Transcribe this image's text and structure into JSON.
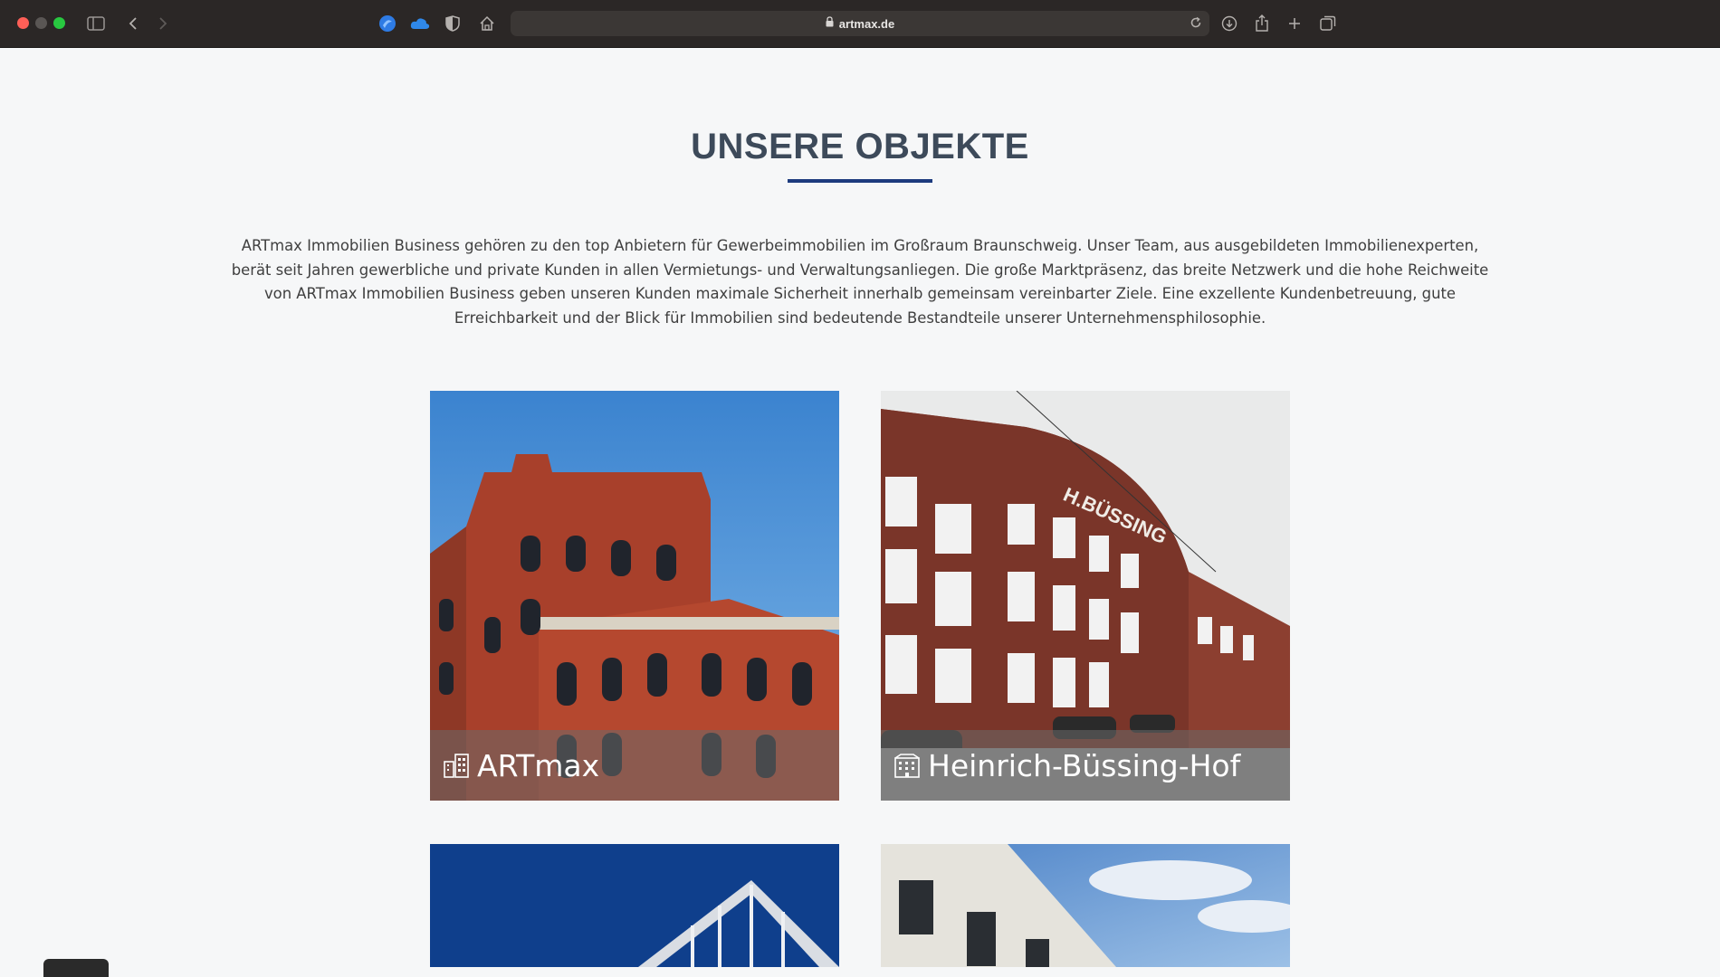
{
  "browser": {
    "url": "artmax.de",
    "icons": [
      "sidebar-icon",
      "back-icon",
      "forward-icon",
      "extension-icon",
      "cloud-icon",
      "shield-icon",
      "home-icon",
      "lock-icon",
      "reload-icon",
      "download-icon",
      "share-icon",
      "new-tab-icon",
      "tabs-overview-icon"
    ]
  },
  "page": {
    "title": "UNSERE OBJEKTE",
    "intro": "ARTmax Immobilien Business gehören zu den top Anbietern für Gewerbeimmobilien im Großraum Braunschweig. Unser Team, aus ausgebildeten Immobilienexperten, berät seit Jahren gewerbliche und private Kunden in allen Vermietungs- und Verwaltungsanliegen. Die große Marktpräsenz, das breite Netzwerk und die hohe Reichweite von ARTmax Immobilien Business geben unseren Kunden maximale Sicherheit innerhalb gemeinsam vereinbarter Ziele. Eine exzellente Kundenbetreuung, gute Erreichbarkeit und der Blick für Immobilien sind bedeutende Bestandteile unserer Unternehmensphilosophie.",
    "accent_color": "#1d3b7e",
    "heading_color": "#3d4a5a"
  },
  "objects": [
    {
      "title": "ARTmax",
      "icon": "building-icon"
    },
    {
      "title": "Heinrich-Büssing-Hof",
      "icon": "building-icon"
    },
    {
      "title": "",
      "icon": ""
    },
    {
      "title": "",
      "icon": ""
    }
  ]
}
